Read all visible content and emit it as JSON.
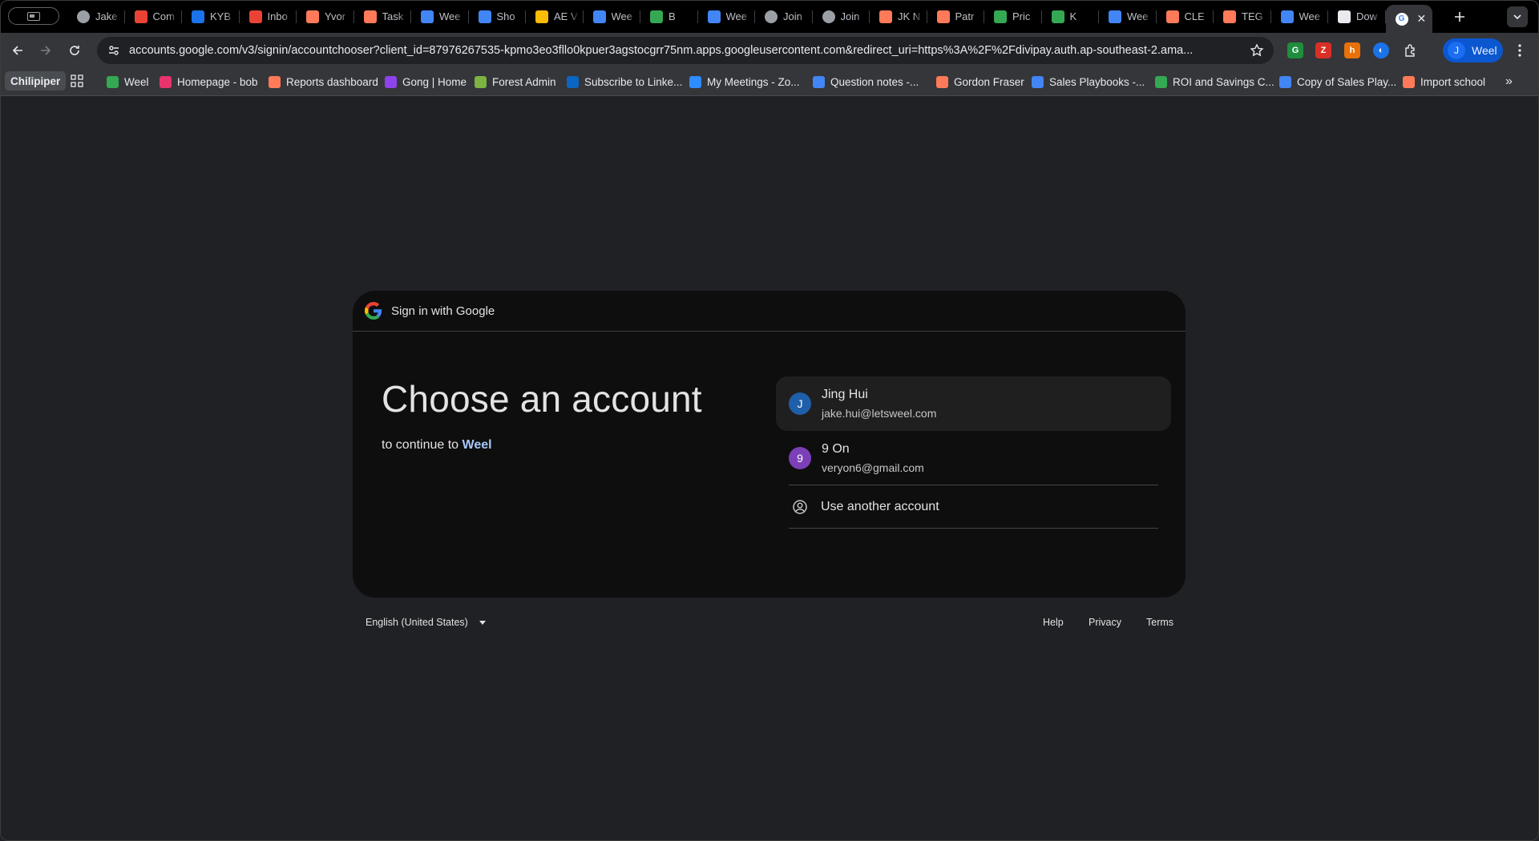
{
  "browser": {
    "tabs": [
      {
        "title": "Jake",
        "icon": "link-icon",
        "color": "#9aa0a6"
      },
      {
        "title": "Com",
        "icon": "gmail-icon",
        "color": "#ea4335"
      },
      {
        "title": "KYB",
        "icon": "bolt-icon",
        "color": "#1a73e8"
      },
      {
        "title": "Inbo",
        "icon": "gmail-icon",
        "color": "#ea4335"
      },
      {
        "title": "Yvor",
        "icon": "hubspot-icon",
        "color": "#ff7a59"
      },
      {
        "title": "Task",
        "icon": "hubspot-icon",
        "color": "#ff7a59"
      },
      {
        "title": "Wee",
        "icon": "calendar-icon",
        "color": "#4285f4"
      },
      {
        "title": "Sho",
        "icon": "docs-icon",
        "color": "#4285f4"
      },
      {
        "title": "AE V",
        "icon": "slides-icon",
        "color": "#fbbc04"
      },
      {
        "title": "Wee",
        "icon": "calendar-icon",
        "color": "#4285f4"
      },
      {
        "title": "B",
        "icon": "palm-icon",
        "color": "#34a853"
      },
      {
        "title": "Wee",
        "icon": "calendar-icon",
        "color": "#4285f4"
      },
      {
        "title": "Join",
        "icon": "link-icon",
        "color": "#9aa0a6"
      },
      {
        "title": "Join",
        "icon": "link-icon",
        "color": "#9aa0a6"
      },
      {
        "title": "JK N",
        "icon": "hubspot-icon",
        "color": "#ff7a59"
      },
      {
        "title": "Patr",
        "icon": "hubspot-icon",
        "color": "#ff7a59"
      },
      {
        "title": "Pric",
        "icon": "clover-icon",
        "color": "#34a853"
      },
      {
        "title": "K",
        "icon": "palm-icon",
        "color": "#34a853"
      },
      {
        "title": "Wee",
        "icon": "calendar-icon",
        "color": "#4285f4"
      },
      {
        "title": "CLE",
        "icon": "hubspot-icon",
        "color": "#ff7a59"
      },
      {
        "title": "TEG",
        "icon": "hubspot-icon",
        "color": "#ff7a59"
      },
      {
        "title": "Wee",
        "icon": "calendar-icon",
        "color": "#4285f4"
      },
      {
        "title": "Dow",
        "icon": "download-icon",
        "color": "#e8eaed"
      }
    ],
    "active_tab_icon": "google-icon",
    "url": "accounts.google.com/v3/signin/accountchooser?client_id=87976267535-kpmo3eo3fllo0kpuer3agstocgrr75nm.apps.googleusercontent.com&redirect_uri=https%3A%2F%2Fdivipay.auth.ap-southeast-2.ama...",
    "profile": {
      "initial": "J",
      "name": "Weel"
    },
    "bookmarks": [
      {
        "label": "Weel",
        "icon": "clover-icon",
        "color": "#34a853"
      },
      {
        "label": "Homepage - bob",
        "icon": "bob-icon",
        "color": "#e8336d"
      },
      {
        "label": "Reports dashboard",
        "icon": "hubspot-icon",
        "color": "#ff7a59"
      },
      {
        "label": "Gong | Home",
        "icon": "gong-icon",
        "color": "#8e44ec"
      },
      {
        "label": "Forest Admin",
        "icon": "forest-icon",
        "color": "#7cb342"
      },
      {
        "label": "Subscribe to Linke...",
        "icon": "linkedin-icon",
        "color": "#0a66c2"
      },
      {
        "label": "My Meetings - Zo...",
        "icon": "zoom-icon",
        "color": "#2d8cff"
      },
      {
        "label": "Question notes -...",
        "icon": "docs-icon",
        "color": "#4285f4"
      },
      {
        "label": "Gordon Fraser",
        "icon": "hubspot-icon",
        "color": "#ff7a59"
      },
      {
        "label": "Sales Playbooks -...",
        "icon": "docs-icon",
        "color": "#4285f4"
      },
      {
        "label": "ROI and Savings C...",
        "icon": "clover-icon",
        "color": "#34a853"
      },
      {
        "label": "Copy of Sales Play...",
        "icon": "docs-icon",
        "color": "#4285f4"
      },
      {
        "label": "Import school",
        "icon": "hubspot-icon",
        "color": "#ff7a59"
      }
    ],
    "bookmark_profile": "Chilipiper"
  },
  "signin": {
    "header": "Sign in with Google",
    "title": "Choose an account",
    "continue_prefix": "to continue to",
    "app_name": "Weel",
    "accounts": [
      {
        "initial": "J",
        "name": "Jing Hui",
        "email": "jake.hui@letsweel.com",
        "color": "#1f5ea8"
      },
      {
        "initial": "9",
        "name": "9 On",
        "email": "veryon6@gmail.com",
        "color": "#7b3fb8"
      }
    ],
    "use_another": "Use another account"
  },
  "footer": {
    "language": "English (United States)",
    "help": "Help",
    "privacy": "Privacy",
    "terms": "Terms"
  }
}
